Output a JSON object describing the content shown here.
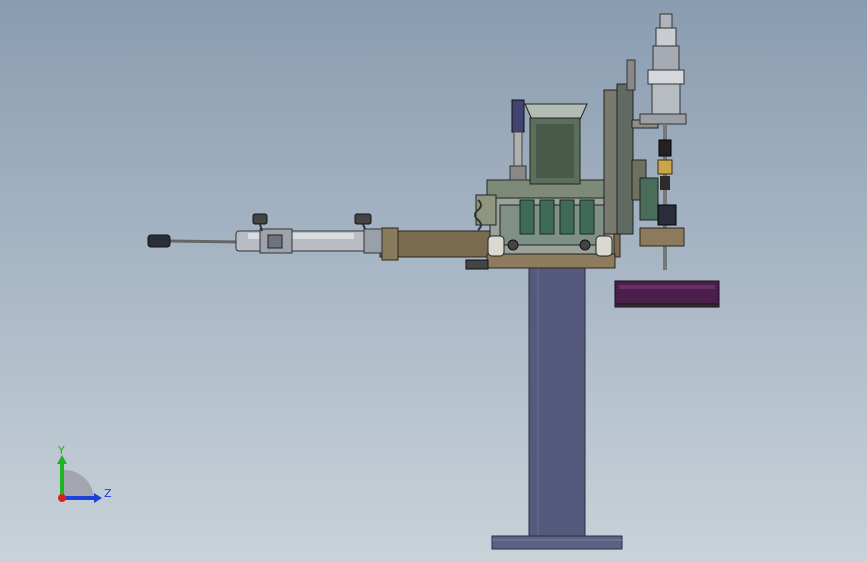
{
  "triad": {
    "y_label": "Y",
    "z_label": "Z",
    "y_color": "#1fb51f",
    "z_color": "#1f3fd9",
    "x_color": "#d92020"
  },
  "palette": {
    "base": "#555a7c",
    "beam": "#7a6a50",
    "hopper": "#5c6e5c",
    "cylinder": "#b8bcc4",
    "tray": "#4a1f4a"
  }
}
